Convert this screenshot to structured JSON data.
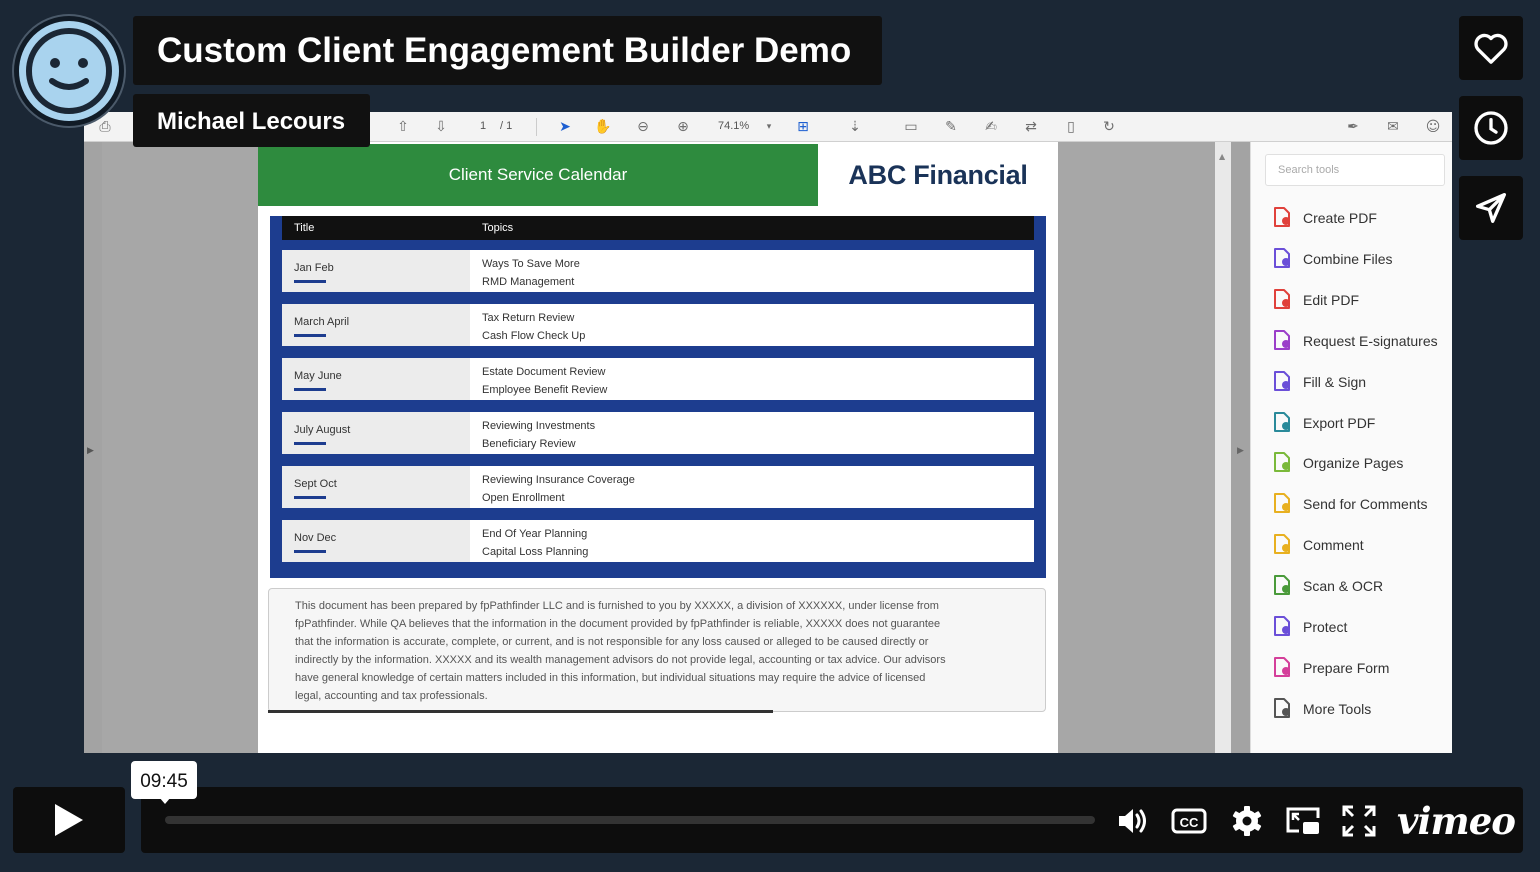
{
  "video": {
    "title": "Custom Client Engagement Builder Demo",
    "author": "Michael Lecours",
    "timestamp": "09:45",
    "brand": "vimeo"
  },
  "pdf_toolbar": {
    "page_current": "1",
    "page_total": "/ 1",
    "zoom": "74.1%"
  },
  "document": {
    "header": "Client Service Calendar",
    "company": "ABC Financial",
    "columns": {
      "title": "Title",
      "topics": "Topics"
    },
    "rows": [
      {
        "period": "Jan Feb",
        "topic1": "Ways To Save More",
        "topic2": "RMD Management"
      },
      {
        "period": "March April",
        "topic1": "Tax Return Review",
        "topic2": "Cash Flow Check Up"
      },
      {
        "period": "May June",
        "topic1": "Estate Document Review",
        "topic2": "Employee Benefit Review"
      },
      {
        "period": "July August",
        "topic1": "Reviewing Investments",
        "topic2": "Beneficiary Review"
      },
      {
        "period": "Sept Oct",
        "topic1": "Reviewing Insurance Coverage",
        "topic2": "Open Enrollment"
      },
      {
        "period": "Nov Dec",
        "topic1": "End Of Year Planning",
        "topic2": "Capital Loss Planning"
      }
    ],
    "disclaimer_lines": [
      "This document has been prepared by fpPathfinder LLC and is furnished to you by XXXXX, a division of XXXXXX, under license from",
      "fpPathfinder. While QA believes that the information in the document provided by fpPathfinder is reliable, XXXXX does not guarantee",
      "that the information is accurate, complete, or current, and is not responsible for any loss caused or alleged to be caused directly or",
      "indirectly by the information. XXXXX and its wealth management advisors do not provide legal, accounting or tax advice. Our advisors",
      "have general knowledge of certain matters included in this information, but individual situations may require the advice of licensed",
      "legal, accounting and tax professionals."
    ]
  },
  "tools_panel": {
    "search_placeholder": "Search tools",
    "tools": [
      {
        "label": "Create PDF",
        "icon": "create-pdf-icon",
        "color": "#e0413b"
      },
      {
        "label": "Combine Files",
        "icon": "combine-files-icon",
        "color": "#6b4fd8"
      },
      {
        "label": "Edit PDF",
        "icon": "edit-pdf-icon",
        "color": "#e0413b"
      },
      {
        "label": "Request E-signatures",
        "icon": "e-signature-icon",
        "color": "#9b3fc9"
      },
      {
        "label": "Fill & Sign",
        "icon": "fill-sign-icon",
        "color": "#6b4fd8"
      },
      {
        "label": "Export PDF",
        "icon": "export-pdf-icon",
        "color": "#2a8a9a"
      },
      {
        "label": "Organize Pages",
        "icon": "organize-pages-icon",
        "color": "#7ab93a"
      },
      {
        "label": "Send for Comments",
        "icon": "send-comments-icon",
        "color": "#e8b020"
      },
      {
        "label": "Comment",
        "icon": "comment-icon",
        "color": "#e8b020"
      },
      {
        "label": "Scan & OCR",
        "icon": "scan-ocr-icon",
        "color": "#4a9a3a"
      },
      {
        "label": "Protect",
        "icon": "protect-icon",
        "color": "#6b4fd8"
      },
      {
        "label": "Prepare Form",
        "icon": "prepare-form-icon",
        "color": "#d43f9a"
      },
      {
        "label": "More Tools",
        "icon": "more-tools-icon",
        "color": "#555555"
      }
    ]
  },
  "colors": {
    "background": "#1b2735",
    "doc_green": "#2e8b3e",
    "doc_navy": "#1d3d8f",
    "brand_text": "#1a3358"
  }
}
